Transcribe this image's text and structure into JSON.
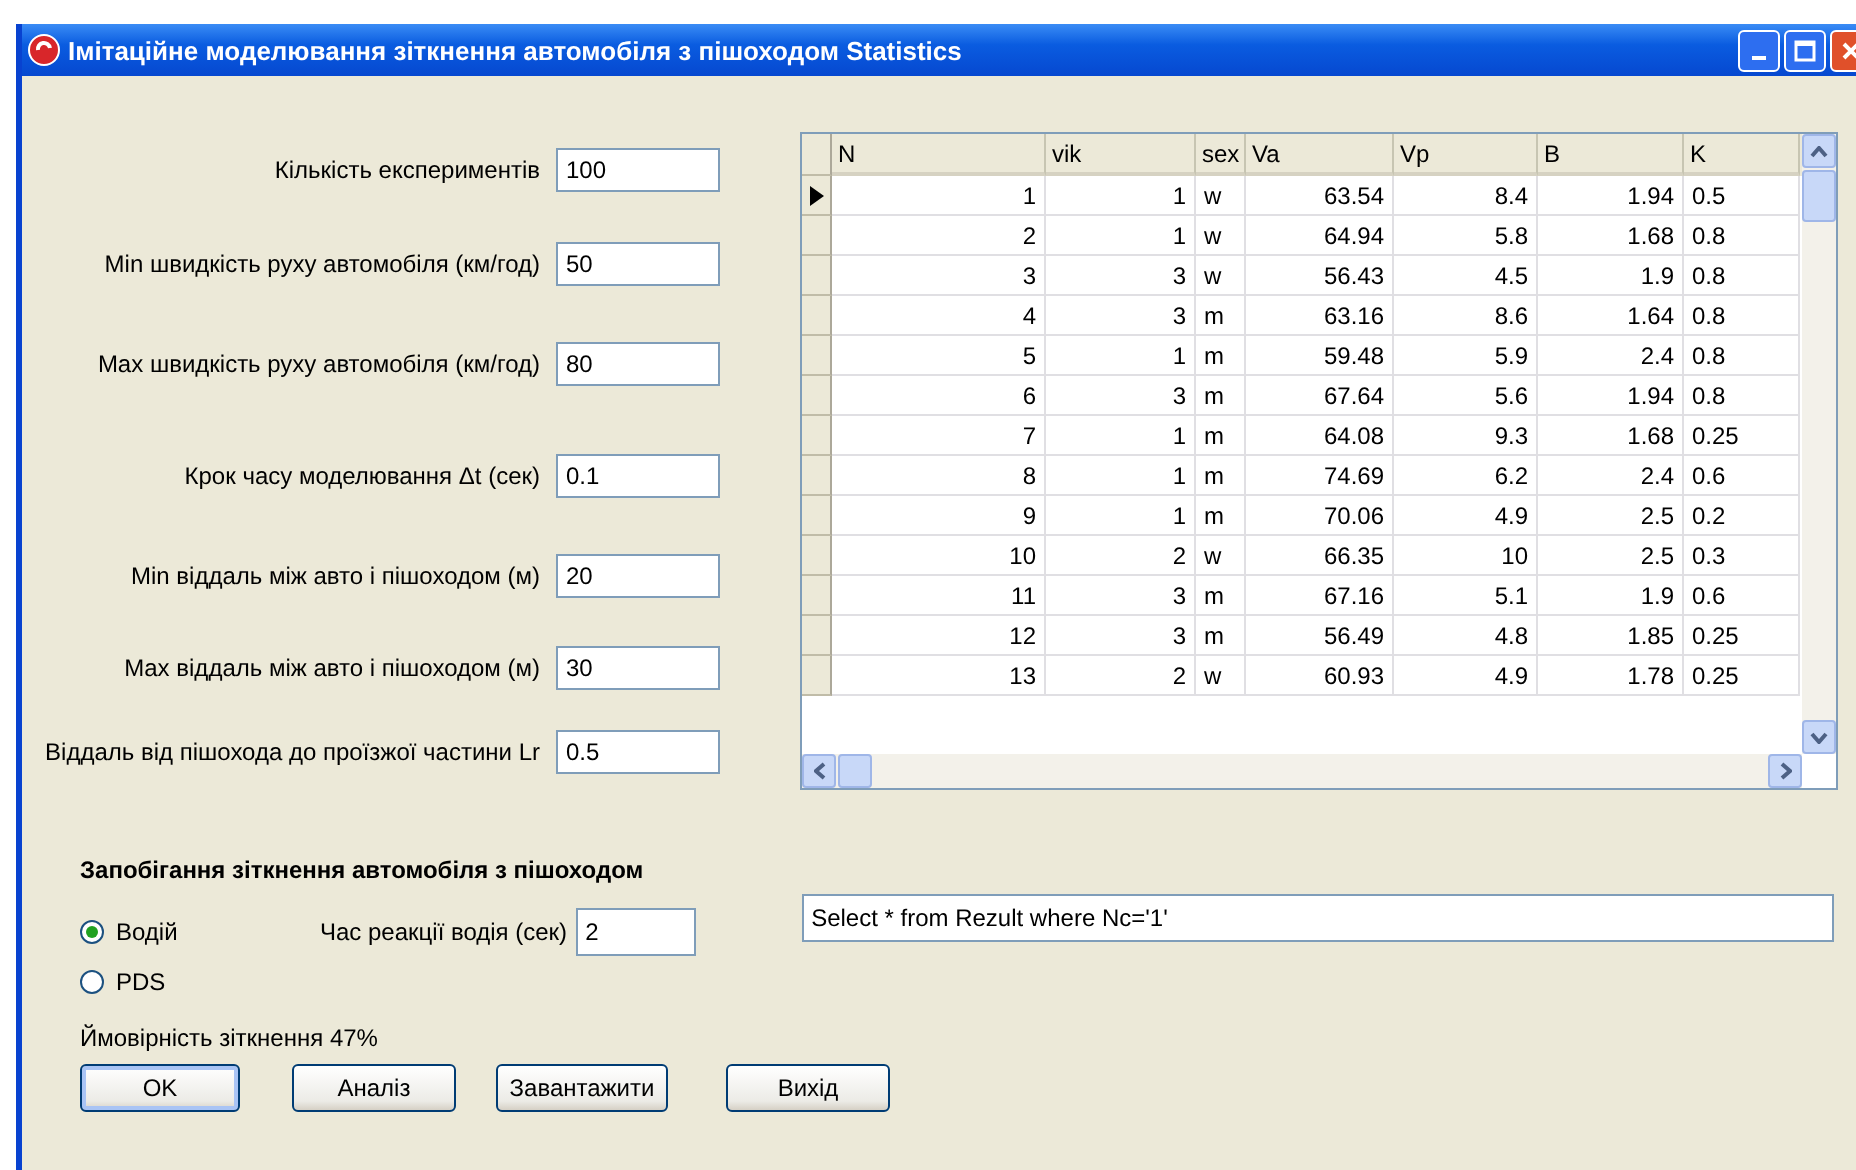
{
  "window": {
    "title": "Імітаційне моделювання зіткнення автомобіля з пішоходом Statistics"
  },
  "params": [
    {
      "label": "Кількість експериментів",
      "value": "100"
    },
    {
      "label": "Min швидкість руху автомобіля  (км/год)",
      "value": "50"
    },
    {
      "label": "Max швидкість руху автомобіля (км/год)",
      "value": "80"
    },
    {
      "label": "Крок часу моделювання Δt (сек)",
      "value": "0.1"
    },
    {
      "label": "Min віддаль між авто і пішоходом (м)",
      "value": "20"
    },
    {
      "label": "Max віддаль між авто і пішоходом (м)",
      "value": "30"
    },
    {
      "label": "Віддаль від пішохода до проїзжої частини Lr",
      "value": "0.5"
    }
  ],
  "table": {
    "columns": [
      "N",
      "vik",
      "sex",
      "Va",
      "Vp",
      "B",
      "K"
    ],
    "rows": [
      {
        "selected": true,
        "cells": [
          "1",
          "1",
          "w",
          "63.54",
          "8.4",
          "1.94",
          "0.5"
        ]
      },
      {
        "selected": false,
        "cells": [
          "2",
          "1",
          "w",
          "64.94",
          "5.8",
          "1.68",
          "0.8"
        ]
      },
      {
        "selected": false,
        "cells": [
          "3",
          "3",
          "w",
          "56.43",
          "4.5",
          "1.9",
          "0.8"
        ]
      },
      {
        "selected": false,
        "cells": [
          "4",
          "3",
          "m",
          "63.16",
          "8.6",
          "1.64",
          "0.8"
        ]
      },
      {
        "selected": false,
        "cells": [
          "5",
          "1",
          "m",
          "59.48",
          "5.9",
          "2.4",
          "0.8"
        ]
      },
      {
        "selected": false,
        "cells": [
          "6",
          "3",
          "m",
          "67.64",
          "5.6",
          "1.94",
          "0.8"
        ]
      },
      {
        "selected": false,
        "cells": [
          "7",
          "1",
          "m",
          "64.08",
          "9.3",
          "1.68",
          "0.25"
        ]
      },
      {
        "selected": false,
        "cells": [
          "8",
          "1",
          "m",
          "74.69",
          "6.2",
          "2.4",
          "0.6"
        ]
      },
      {
        "selected": false,
        "cells": [
          "9",
          "1",
          "m",
          "70.06",
          "4.9",
          "2.5",
          "0.2"
        ]
      },
      {
        "selected": false,
        "cells": [
          "10",
          "2",
          "w",
          "66.35",
          "10",
          "2.5",
          "0.3"
        ]
      },
      {
        "selected": false,
        "cells": [
          "11",
          "3",
          "m",
          "67.16",
          "5.1",
          "1.9",
          "0.6"
        ]
      },
      {
        "selected": false,
        "cells": [
          "12",
          "3",
          "m",
          "56.49",
          "4.8",
          "1.85",
          "0.25"
        ]
      },
      {
        "selected": false,
        "cells": [
          "13",
          "2",
          "w",
          "60.93",
          "4.9",
          "1.78",
          "0.25"
        ]
      }
    ]
  },
  "prevention": {
    "heading": "Запобігання зіткнення автомобіля з пішоходом",
    "options": [
      {
        "label": "Водій",
        "selected": true
      },
      {
        "label": "PDS",
        "selected": false
      }
    ],
    "reaction": {
      "label": "Час реакції водія (сек)",
      "value": "2"
    },
    "query": {
      "value": "Select * from Rezult where Nc='1'"
    },
    "probability": "Ймовірність зіткнення 47%"
  },
  "buttons": [
    {
      "label": "OK",
      "default": true
    },
    {
      "label": "Аналіз",
      "default": false
    },
    {
      "label": "Завантажити",
      "default": false
    },
    {
      "label": "Вихід",
      "default": false
    }
  ]
}
